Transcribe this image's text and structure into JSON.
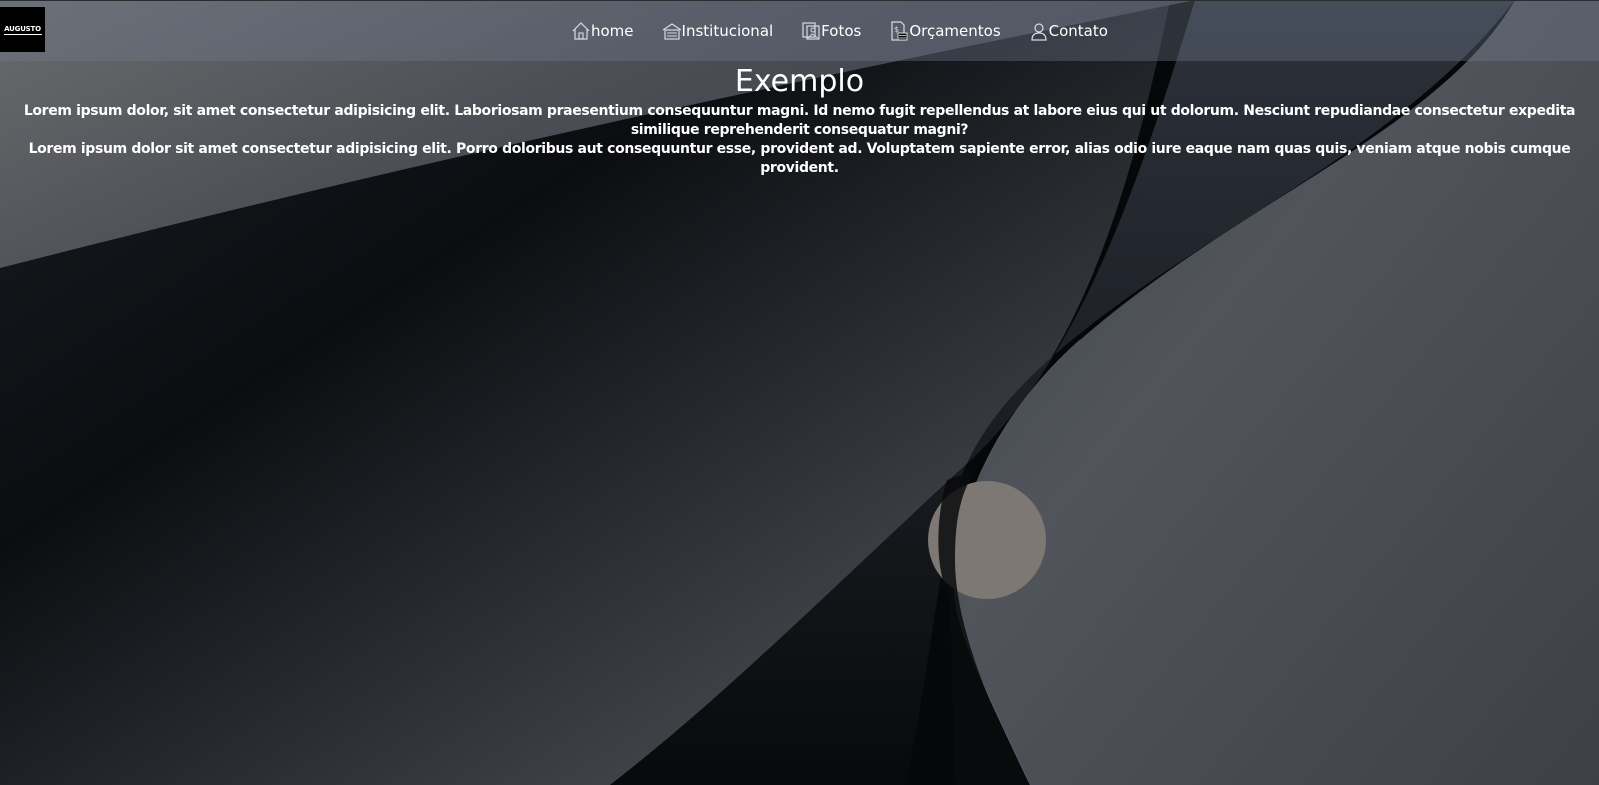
{
  "logo": {
    "text": "AUGUSTO"
  },
  "nav": {
    "items": [
      {
        "label": "home",
        "icon": "home-icon"
      },
      {
        "label": "Institucional",
        "icon": "building-icon"
      },
      {
        "label": "Fotos",
        "icon": "photo-icon"
      },
      {
        "label": "Orçamentos",
        "icon": "budget-document-icon"
      },
      {
        "label": "Contato",
        "icon": "user-icon"
      }
    ]
  },
  "main": {
    "title": "Exemplo",
    "paragraphs": [
      "Lorem ipsum dolor, sit amet consectetur adipisicing elit. Laboriosam praesentium consequuntur magni. Id nemo fugit repellendus at labore eius qui ut dolorum. Nesciunt repudiandae consectetur expedita similique reprehenderit consequatur magni?",
      "Lorem ipsum dolor sit amet consectetur adipisicing elit. Porro doloribus aut consequuntur esse, provident ad. Voluptatem sapiente error, alias odio iure eaque nam quas quis, veniam atque nobis cumque provident."
    ]
  },
  "colors": {
    "text": "#ffffff",
    "navbar": "#5a6476",
    "background_dark": "#050608",
    "background_light": "#4a4d52",
    "moon": "#7d7873"
  }
}
